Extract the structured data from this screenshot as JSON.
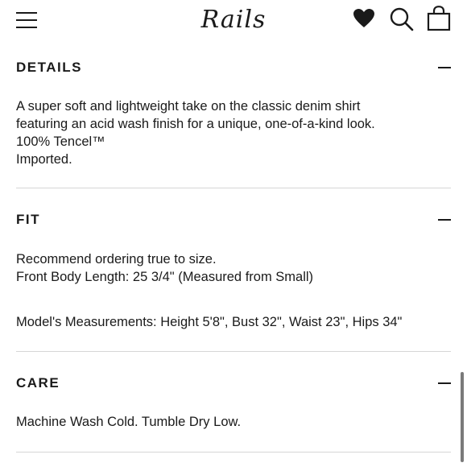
{
  "header": {
    "brand": "Rails",
    "icons": [
      "menu-icon",
      "heart-icon",
      "search-icon",
      "shopping-bag-icon"
    ]
  },
  "sections": [
    {
      "title": "DETAILS",
      "lines": [
        "A super soft and lightweight take on the classic denim shirt",
        "featuring an acid wash finish for a unique, one-of-a-kind look.",
        "100% Tencel™",
        "Imported."
      ]
    },
    {
      "title": "FIT",
      "lines": [
        "Recommend ordering true to size.",
        "Front Body Length: 25 3/4\" (Measured from Small)",
        "Model's Measurements: Height 5'8\", Bust 32\", Waist 23\", Hips 34\""
      ]
    },
    {
      "title": "CARE",
      "lines": [
        "Machine Wash Cold. Tumble Dry Low."
      ]
    }
  ],
  "colors": {
    "text": "#1a1a1a",
    "divider": "#d6d6d6",
    "background": "#ffffff"
  }
}
